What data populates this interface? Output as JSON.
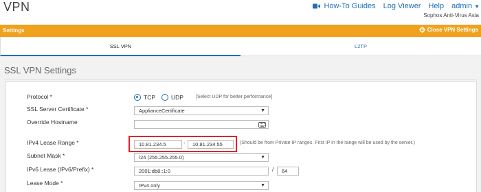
{
  "header": {
    "title": "VPN",
    "links": {
      "how_to": "How-To Guides",
      "log_viewer": "Log Viewer",
      "help": "Help",
      "user": "admin"
    },
    "organization": "Sophos Anti-Virus Asia"
  },
  "settings_bar": {
    "label": "Settings",
    "close_label": "Close VPN Settings"
  },
  "tabs": [
    "SSL VPN",
    "L2TP"
  ],
  "section": {
    "title": "SSL VPN Settings"
  },
  "form": {
    "protocol": {
      "label": "Protocol *",
      "options": [
        "TCP",
        "UDP"
      ],
      "selected": "TCP",
      "hint": "[Select UDP for better performance]"
    },
    "certificate": {
      "label": "SSL Server Certificate *",
      "value": "ApplianceCertificate"
    },
    "hostname": {
      "label": "Override Hostname",
      "value": ""
    },
    "lease_range": {
      "label": "IPv4 Lease Range *",
      "start": "10.81.234.5",
      "separator": "-",
      "end": "10.81.234.55",
      "hint": "Should be from Private IP ranges. First IP in the range will be used by the server."
    },
    "subnet": {
      "label": "Subnet Mask *",
      "value": "/24 (255.255.255.0)"
    },
    "ipv6": {
      "label": "IPv6 Lease (IPv6/Prefix) *",
      "value": "2001:db8::1:0",
      "separator": "/",
      "prefix": "64"
    },
    "lease_mode": {
      "label": "Lease Mode *",
      "value": "IPv4 only"
    }
  },
  "colors": {
    "accent": "#f0a21f",
    "link": "#1f6fb5",
    "highlight": "#e0242a"
  }
}
